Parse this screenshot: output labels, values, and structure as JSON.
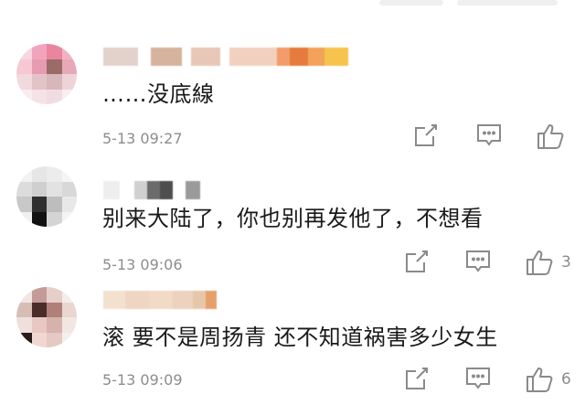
{
  "comments": [
    {
      "text": "……没底線",
      "time": "5-13 09:27",
      "like_count": ""
    },
    {
      "text": "别来大陆了，你也别再发他了，不想看",
      "time": "5-13 09:06",
      "like_count": "3"
    },
    {
      "text": "滚  要不是周扬青  还不知道祸害多少女生",
      "time": "5-13 09:09",
      "like_count": "6"
    }
  ],
  "icons": [
    "share-icon",
    "comment-icon",
    "like-icon"
  ],
  "colors": {
    "text": "#1a1a1a",
    "meta": "#8c8c8c",
    "icon": "#8a8a8a"
  }
}
